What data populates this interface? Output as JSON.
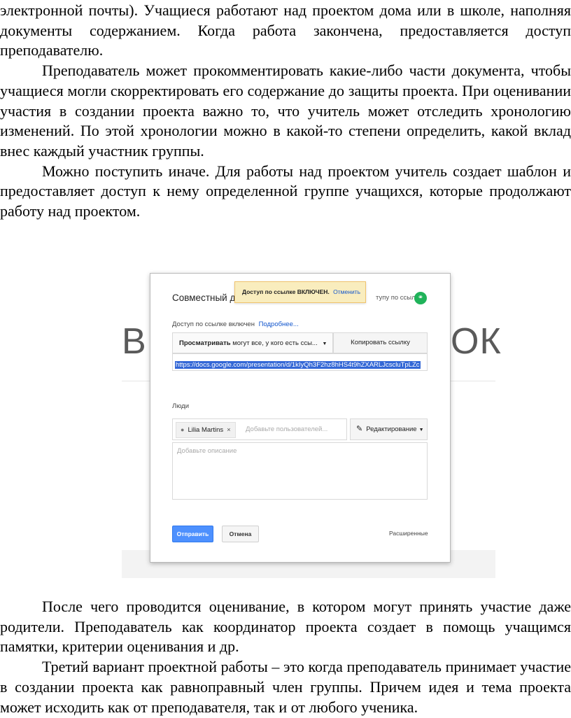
{
  "paragraphs_top": [
    {
      "text": "электронной почты). Учащиеся работают над проектом дома или в школе, наполняя документы содержанием. Когда работа закончена, предоставляется доступ преподавателю."
    },
    {
      "text": "Преподаватель может прокомментировать какие-либо части документа, чтобы учащиеся могли скорректировать его содержание до защиты проекта. При оценивании участия в создании проекта важно то, что учитель может отследить хронологию изменений. По этой хронологии можно в какой-то степени определить, какой вклад внес каждый участник группы."
    },
    {
      "text": "Можно поступить иначе. Для работы над проектом учитель создает шаблон и предоставляет доступ к нему определенной группе учащихся, которые продолжают работу над проектом."
    }
  ],
  "paragraphs_bottom": [
    {
      "text": "После чего проводится оценивание, в котором могут принять участие даже родители. Преподаватель как координатор проекта создает в помощь учащимся памятки, критерии оценивания и др."
    },
    {
      "text": "Третий вариант проектной работы – это когда преподаватель принимает участие в создании проекта как равноправный член группы. Причем идея и тема проекта может исходить как от преподавателя, так и от любого ученика."
    }
  ],
  "figure": {
    "background_left": "В",
    "background_right": "ОК",
    "dialog": {
      "title": "Совместный до",
      "toast_text": "Доступ по ссылке ВКЛЮЧЕН.",
      "toast_undo": "Отменить",
      "link_status_short": "тупу по ссылке",
      "access_text": "Доступ по ссылке включен",
      "more_link": "Подробнее...",
      "permission_bold": "Просматривать",
      "permission_rest": "могут все, у кого есть ссы...",
      "copy_button": "Копировать ссылку",
      "url": "https://docs.google.com/presentation/d/1kIyQh3F2hz8hHS4t9hZXARLJcscluTpLZc",
      "people_label": "Люди",
      "chip_name": "Lilia Martins",
      "people_placeholder": "Добавьте пользователей...",
      "edit_button": "Редактирование",
      "description_placeholder": "Добавьте описание",
      "send_button": "Отправить",
      "cancel_button": "Отмена",
      "advanced_link": "Расширенные"
    }
  }
}
